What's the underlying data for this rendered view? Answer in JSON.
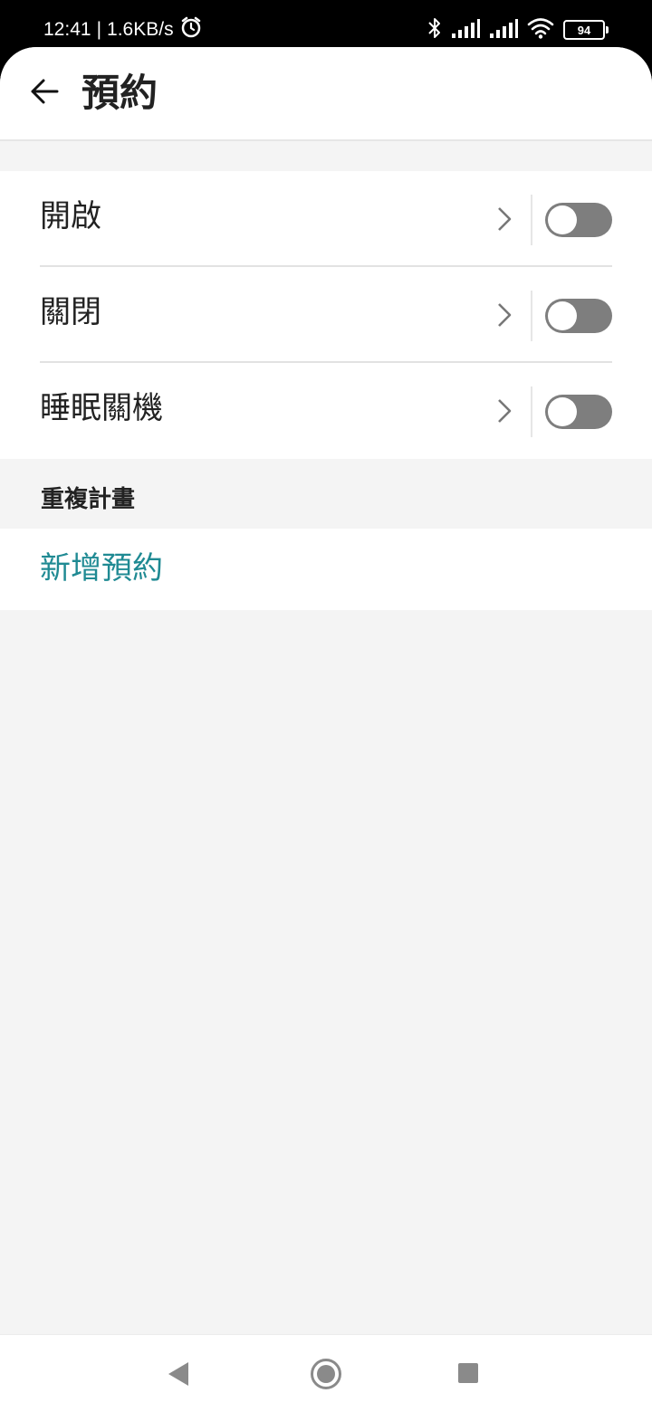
{
  "status_bar": {
    "time": "12:41",
    "separator": "|",
    "network_speed": "1.6KB/s",
    "battery_level": "94",
    "icons": [
      "alarm-icon",
      "bluetooth-icon",
      "signal-icon",
      "signal-icon",
      "wifi-icon",
      "battery-icon"
    ]
  },
  "header": {
    "title": "預約",
    "back_icon": "arrow-left-icon"
  },
  "schedules": [
    {
      "label": "開啟",
      "enabled": false
    },
    {
      "label": "關閉",
      "enabled": false
    },
    {
      "label": "睡眠關機",
      "enabled": false
    }
  ],
  "repeat_section": {
    "title": "重複計畫",
    "add_label": "新增預約"
  },
  "colors": {
    "accent": "#1f8a93",
    "toggle_off": "#7e7e7e",
    "background": "#f4f4f4"
  },
  "nav_bar": {
    "icons": [
      "nav-back-icon",
      "nav-home-icon",
      "nav-recents-icon"
    ]
  }
}
